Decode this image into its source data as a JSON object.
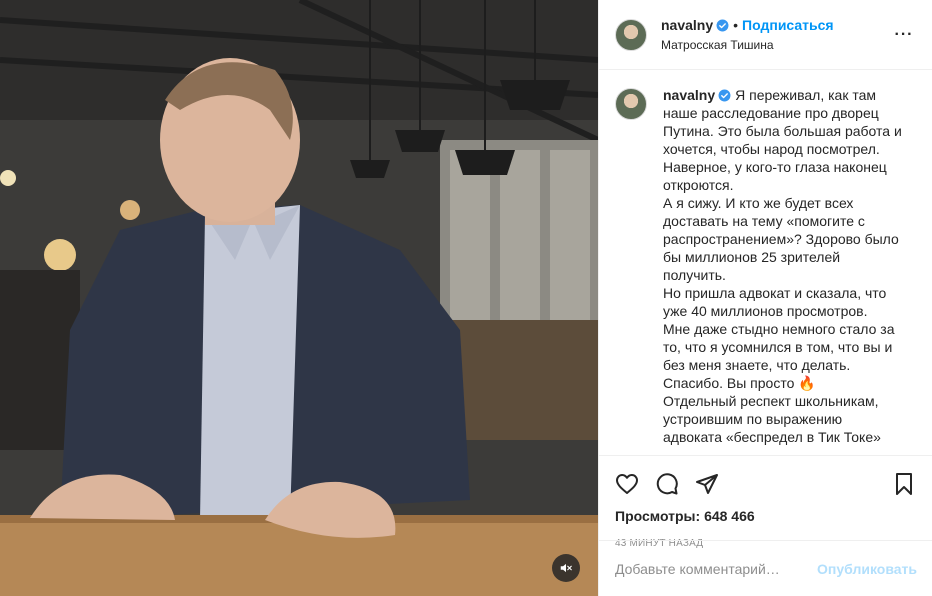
{
  "post": {
    "username": "navalny",
    "follow_label": "Подписаться",
    "dot": "•",
    "location": "Матросская Тишина",
    "more_label": "···"
  },
  "caption": {
    "username": "navalny",
    "text": "Я переживал, как там наше расследование про дворец Путина. Это была большая работа и хочется, чтобы народ посмотрел. Наверное, у кого-то глаза наконец откроются.\nА я сижу. И кто же будет всех доставать на тему «помогите с распространением»? Здорово было бы миллионов 25 зрителей получить.\nНо пришла адвокат и сказала, что уже 40 миллионов просмотров.\nМне даже стыдно немного стало за то, что я усомнился в том, что вы и без меня знаете, что делать.\nСпасибо. Вы просто 🔥\nОтдельный респект школьникам, устроившим по выражению адвоката «беспредел в Тик Токе»"
  },
  "stats": {
    "views_label": "Просмотры:",
    "views_value": "648 466",
    "time_ago": "43 МИНУТ НАЗАД"
  },
  "comment_box": {
    "placeholder": "Добавьте комментарий…",
    "publish_label": "Опубликовать"
  },
  "colors": {
    "accent": "#0095f6",
    "publish_disabled": "#b2dffc",
    "verified": "#3897f0"
  },
  "icons": [
    "verified-badge-icon",
    "more-options-icon",
    "heart-icon",
    "comment-icon",
    "share-icon",
    "bookmark-icon",
    "speaker-muted-icon"
  ]
}
